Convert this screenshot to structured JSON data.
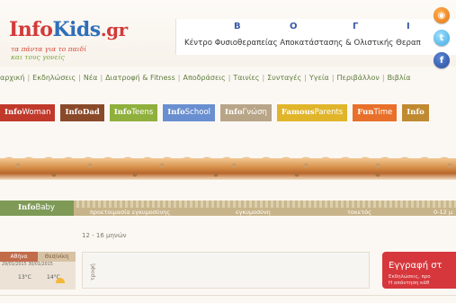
{
  "header": {
    "logo": {
      "info": "Info",
      "kids": "Kids",
      "gr": ".gr"
    },
    "tagline": {
      "line1": "τα πάντα για το παιδί",
      "line2": "και τους γονείς"
    },
    "banner": {
      "letters": [
        "Β",
        "Ο",
        "Γ",
        "Ι"
      ],
      "subtitle": "Κέντρο Φυσιοθεραπείας Αποκατάστασης & Ολιστικής Θεραπ"
    },
    "social": [
      "rss-icon",
      "twitter-icon",
      "facebook-icon"
    ]
  },
  "nav": {
    "items": [
      "αρχική",
      "Εκδηλώσεις",
      "Νέα",
      "Διατροφή & Fitness",
      "Αποδράσεις",
      "Ταινίες",
      "Συνταγές",
      "Υγεία",
      "Περιβάλλον",
      "Βιβλία"
    ]
  },
  "categories": [
    {
      "bold": "Info",
      "rest": "Woman",
      "color": "#c0392b"
    },
    {
      "bold": "InfoDad",
      "rest": "",
      "color": "#8a4a2a"
    },
    {
      "bold": "Info",
      "rest": "Teens",
      "color": "#8fb03c"
    },
    {
      "bold": "Info",
      "rest": "School",
      "color": "#6a8fd0"
    },
    {
      "bold": "Info",
      "rest": "Γνώση",
      "color": "#b8a588"
    },
    {
      "bold": "Famous",
      "rest": "Parents",
      "color": "#e0b52a"
    },
    {
      "bold": "Fun",
      "rest": "Time",
      "color": "#e8702a"
    },
    {
      "bold": "Info",
      "rest": "",
      "color": "#c08a30"
    }
  ],
  "infobaby": {
    "tab": {
      "bold": "Info",
      "rest": "Baby"
    },
    "subtabs": [
      "προετοιμασία εγκυμοσύνης",
      "εγκυμοσύνη",
      "τοκετός",
      "0-12 μ"
    ]
  },
  "age_label": "12 - 16 μηνών",
  "weather": {
    "tabs": [
      "Αθήνα",
      "Θεσ/νίκη"
    ],
    "dates": [
      "29/01/2015",
      "30/01/2015"
    ],
    "temps": [
      "13°C",
      "14°C"
    ]
  },
  "panel": {
    "label": "τροφή"
  },
  "register": {
    "title": "Εγγραφή στ",
    "line1": "Εκδηλώσεις, προ",
    "line2": "Η απάντηση κάθ"
  },
  "colors": {
    "accent_red": "#d6373c",
    "nav_green": "#5d7a3c",
    "baby_green": "#7e9a56"
  }
}
